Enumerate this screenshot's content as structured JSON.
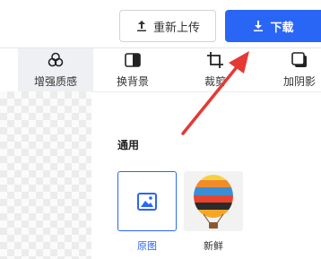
{
  "topbar": {
    "reupload_label": "重新上传",
    "download_label": "下载",
    "accent": "#2a66f5"
  },
  "tools": [
    {
      "label": "增强质感",
      "icon": "circles-icon",
      "active": true
    },
    {
      "label": "换背景",
      "icon": "background-swap-icon",
      "active": false
    },
    {
      "label": "裁剪",
      "icon": "crop-icon",
      "active": false
    },
    {
      "label": "加阴影",
      "icon": "shadow-icon",
      "active": false
    }
  ],
  "panel": {
    "section_title": "通用",
    "filters": [
      {
        "label": "原图",
        "icon": "image-icon",
        "selected": true
      },
      {
        "label": "新鲜",
        "icon": "hot-air-balloon-image",
        "selected": false
      }
    ]
  },
  "annotation": {
    "color": "#e53935",
    "icon": "red-arrow"
  }
}
